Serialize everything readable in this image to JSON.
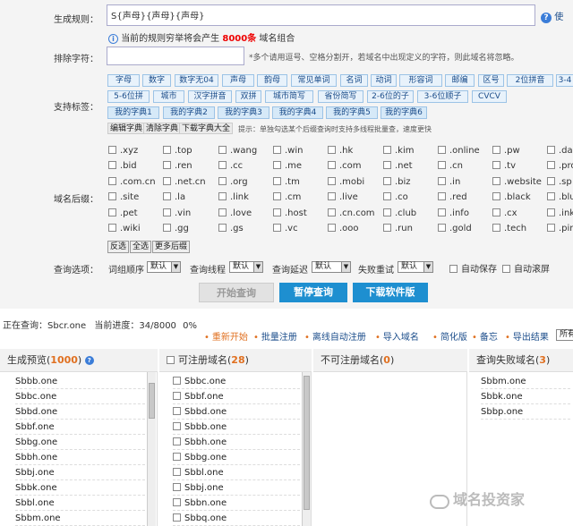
{
  "form": {
    "rule_label": "生成规则：",
    "rule_value": "S{声母}{声母}{声母}",
    "rule_help": "?",
    "rule_help_text": "使",
    "hint_prefix": "当前的规则穷举将会产生",
    "hint_count": "8000条",
    "hint_suffix": "域名组合",
    "exclude_label": "排除字符：",
    "exclude_value": "",
    "exclude_hint": "*多个请用逗号、空格分割开，若域名中出现定义的字符，则此域名将忽略。",
    "tags_label": "支持标签：",
    "suffix_label": "域名后缀：",
    "options_label": "查询选项："
  },
  "tags_row1": [
    "字母",
    "数字",
    "数字无04",
    "声母",
    "韵母",
    "常见单词",
    "名词",
    "动词",
    "形容词",
    "邮编",
    "区号",
    "2位拼音",
    "3-4"
  ],
  "tags_row2": [
    "5-6位拼",
    "城市",
    "汉字拼音",
    "双拼",
    "城市简写",
    "省份简写",
    "2-6位的子",
    "3-6位顺子",
    "CVCV"
  ],
  "tags_row3": [
    "我的字典1",
    "我的字典2",
    "我的字典3",
    "我的字典4",
    "我的字典5",
    "我的字典6"
  ],
  "dict_tools": {
    "edit": "编辑字典",
    "clear": "清除字典",
    "download": "下载字典大全",
    "tip": "提示：单独勾选某个后缀查询时支持多线程批量查，速度更快"
  },
  "suffixes": [
    [
      ".xyz",
      ".top",
      ".wang",
      ".win",
      ".hk",
      ".kim",
      ".online",
      ".pw",
      ".da"
    ],
    [
      ".bid",
      ".ren",
      ".cc",
      ".me",
      ".com",
      ".net",
      ".cn",
      ".tv",
      ".pro"
    ],
    [
      ".com.cn",
      ".net.cn",
      ".org",
      ".tm",
      ".mobi",
      ".biz",
      ".in",
      ".website",
      ".sp"
    ],
    [
      ".site",
      ".la",
      ".link",
      ".cm",
      ".live",
      ".co",
      ".red",
      ".black",
      ".blu"
    ],
    [
      ".pet",
      ".vin",
      ".love",
      ".host",
      ".cn.com",
      ".club",
      ".info",
      ".cx",
      ".ink"
    ],
    [
      ".wiki",
      ".gg",
      ".gs",
      ".vc",
      ".ooo",
      ".run",
      ".gold",
      ".tech",
      ".pin"
    ]
  ],
  "suffix_buttons": {
    "invert": "反选",
    "all": "全选",
    "more": "更多后缀"
  },
  "options": {
    "order_label": "词组顺序",
    "order_value": "默认",
    "threads_label": "查询线程",
    "threads_value": "默认",
    "delay_label": "查询延迟",
    "delay_value": "默认",
    "retry_label": "失败重试",
    "retry_value": "默认",
    "autosave": "自动保存",
    "autoscroll": "自动滚屏"
  },
  "actions": {
    "start": "开始查询",
    "pause": "暂停查询",
    "download": "下载软件版"
  },
  "status": {
    "current_prefix": "正在查询：",
    "current_value": "Sbcr.one",
    "progress_label": "当前进度：",
    "progress_value": "34/8000",
    "percent": "0%"
  },
  "toolbar": [
    "重新开始",
    "批量注册",
    "离线自动注册",
    "导入域名",
    "简化版",
    "备忘",
    "导出结果"
  ],
  "toolbar_select": "所有",
  "columns": {
    "preview_title": "生成预览(",
    "preview_count": "1000",
    "preview_close": ")",
    "available_title": "可注册域名(",
    "available_count": "28",
    "unavailable_title": "不可注册域名(",
    "unavailable_count": "0",
    "failed_title": "查询失败域名(",
    "failed_count": "3",
    "close": ")"
  },
  "preview_list": [
    "Sbbb.one",
    "Sbbc.one",
    "Sbbd.one",
    "Sbbf.one",
    "Sbbg.one",
    "Sbbh.one",
    "Sbbj.one",
    "Sbbk.one",
    "Sbbl.one",
    "Sbbm.one",
    "Sbbn.one"
  ],
  "available_list": [
    "Sbbc.one",
    "Sbbf.one",
    "Sbbd.one",
    "Sbbb.one",
    "Sbbh.one",
    "Sbbg.one",
    "Sbbl.one",
    "Sbbj.one",
    "Sbbn.one",
    "Sbbq.one"
  ],
  "failed_list": [
    "Sbbm.one",
    "Sbbk.one",
    "Sbbp.one"
  ],
  "watermark": "域名投资家",
  "colors": {
    "accent": "#1e8fd0",
    "count": "#e07020",
    "red": "#e00000"
  }
}
